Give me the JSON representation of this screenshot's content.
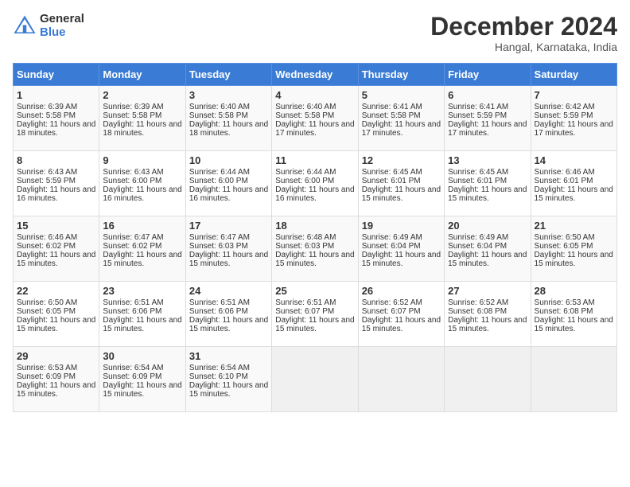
{
  "header": {
    "logo_general": "General",
    "logo_blue": "Blue",
    "month_title": "December 2024",
    "location": "Hangal, Karnataka, India"
  },
  "weekdays": [
    "Sunday",
    "Monday",
    "Tuesday",
    "Wednesday",
    "Thursday",
    "Friday",
    "Saturday"
  ],
  "weeks": [
    [
      {
        "day": "1",
        "sunrise": "Sunrise: 6:39 AM",
        "sunset": "Sunset: 5:58 PM",
        "daylight": "Daylight: 11 hours and 18 minutes."
      },
      {
        "day": "2",
        "sunrise": "Sunrise: 6:39 AM",
        "sunset": "Sunset: 5:58 PM",
        "daylight": "Daylight: 11 hours and 18 minutes."
      },
      {
        "day": "3",
        "sunrise": "Sunrise: 6:40 AM",
        "sunset": "Sunset: 5:58 PM",
        "daylight": "Daylight: 11 hours and 18 minutes."
      },
      {
        "day": "4",
        "sunrise": "Sunrise: 6:40 AM",
        "sunset": "Sunset: 5:58 PM",
        "daylight": "Daylight: 11 hours and 17 minutes."
      },
      {
        "day": "5",
        "sunrise": "Sunrise: 6:41 AM",
        "sunset": "Sunset: 5:58 PM",
        "daylight": "Daylight: 11 hours and 17 minutes."
      },
      {
        "day": "6",
        "sunrise": "Sunrise: 6:41 AM",
        "sunset": "Sunset: 5:59 PM",
        "daylight": "Daylight: 11 hours and 17 minutes."
      },
      {
        "day": "7",
        "sunrise": "Sunrise: 6:42 AM",
        "sunset": "Sunset: 5:59 PM",
        "daylight": "Daylight: 11 hours and 17 minutes."
      }
    ],
    [
      {
        "day": "8",
        "sunrise": "Sunrise: 6:43 AM",
        "sunset": "Sunset: 5:59 PM",
        "daylight": "Daylight: 11 hours and 16 minutes."
      },
      {
        "day": "9",
        "sunrise": "Sunrise: 6:43 AM",
        "sunset": "Sunset: 6:00 PM",
        "daylight": "Daylight: 11 hours and 16 minutes."
      },
      {
        "day": "10",
        "sunrise": "Sunrise: 6:44 AM",
        "sunset": "Sunset: 6:00 PM",
        "daylight": "Daylight: 11 hours and 16 minutes."
      },
      {
        "day": "11",
        "sunrise": "Sunrise: 6:44 AM",
        "sunset": "Sunset: 6:00 PM",
        "daylight": "Daylight: 11 hours and 16 minutes."
      },
      {
        "day": "12",
        "sunrise": "Sunrise: 6:45 AM",
        "sunset": "Sunset: 6:01 PM",
        "daylight": "Daylight: 11 hours and 15 minutes."
      },
      {
        "day": "13",
        "sunrise": "Sunrise: 6:45 AM",
        "sunset": "Sunset: 6:01 PM",
        "daylight": "Daylight: 11 hours and 15 minutes."
      },
      {
        "day": "14",
        "sunrise": "Sunrise: 6:46 AM",
        "sunset": "Sunset: 6:01 PM",
        "daylight": "Daylight: 11 hours and 15 minutes."
      }
    ],
    [
      {
        "day": "15",
        "sunrise": "Sunrise: 6:46 AM",
        "sunset": "Sunset: 6:02 PM",
        "daylight": "Daylight: 11 hours and 15 minutes."
      },
      {
        "day": "16",
        "sunrise": "Sunrise: 6:47 AM",
        "sunset": "Sunset: 6:02 PM",
        "daylight": "Daylight: 11 hours and 15 minutes."
      },
      {
        "day": "17",
        "sunrise": "Sunrise: 6:47 AM",
        "sunset": "Sunset: 6:03 PM",
        "daylight": "Daylight: 11 hours and 15 minutes."
      },
      {
        "day": "18",
        "sunrise": "Sunrise: 6:48 AM",
        "sunset": "Sunset: 6:03 PM",
        "daylight": "Daylight: 11 hours and 15 minutes."
      },
      {
        "day": "19",
        "sunrise": "Sunrise: 6:49 AM",
        "sunset": "Sunset: 6:04 PM",
        "daylight": "Daylight: 11 hours and 15 minutes."
      },
      {
        "day": "20",
        "sunrise": "Sunrise: 6:49 AM",
        "sunset": "Sunset: 6:04 PM",
        "daylight": "Daylight: 11 hours and 15 minutes."
      },
      {
        "day": "21",
        "sunrise": "Sunrise: 6:50 AM",
        "sunset": "Sunset: 6:05 PM",
        "daylight": "Daylight: 11 hours and 15 minutes."
      }
    ],
    [
      {
        "day": "22",
        "sunrise": "Sunrise: 6:50 AM",
        "sunset": "Sunset: 6:05 PM",
        "daylight": "Daylight: 11 hours and 15 minutes."
      },
      {
        "day": "23",
        "sunrise": "Sunrise: 6:51 AM",
        "sunset": "Sunset: 6:06 PM",
        "daylight": "Daylight: 11 hours and 15 minutes."
      },
      {
        "day": "24",
        "sunrise": "Sunrise: 6:51 AM",
        "sunset": "Sunset: 6:06 PM",
        "daylight": "Daylight: 11 hours and 15 minutes."
      },
      {
        "day": "25",
        "sunrise": "Sunrise: 6:51 AM",
        "sunset": "Sunset: 6:07 PM",
        "daylight": "Daylight: 11 hours and 15 minutes."
      },
      {
        "day": "26",
        "sunrise": "Sunrise: 6:52 AM",
        "sunset": "Sunset: 6:07 PM",
        "daylight": "Daylight: 11 hours and 15 minutes."
      },
      {
        "day": "27",
        "sunrise": "Sunrise: 6:52 AM",
        "sunset": "Sunset: 6:08 PM",
        "daylight": "Daylight: 11 hours and 15 minutes."
      },
      {
        "day": "28",
        "sunrise": "Sunrise: 6:53 AM",
        "sunset": "Sunset: 6:08 PM",
        "daylight": "Daylight: 11 hours and 15 minutes."
      }
    ],
    [
      {
        "day": "29",
        "sunrise": "Sunrise: 6:53 AM",
        "sunset": "Sunset: 6:09 PM",
        "daylight": "Daylight: 11 hours and 15 minutes."
      },
      {
        "day": "30",
        "sunrise": "Sunrise: 6:54 AM",
        "sunset": "Sunset: 6:09 PM",
        "daylight": "Daylight: 11 hours and 15 minutes."
      },
      {
        "day": "31",
        "sunrise": "Sunrise: 6:54 AM",
        "sunset": "Sunset: 6:10 PM",
        "daylight": "Daylight: 11 hours and 15 minutes."
      },
      null,
      null,
      null,
      null
    ]
  ]
}
